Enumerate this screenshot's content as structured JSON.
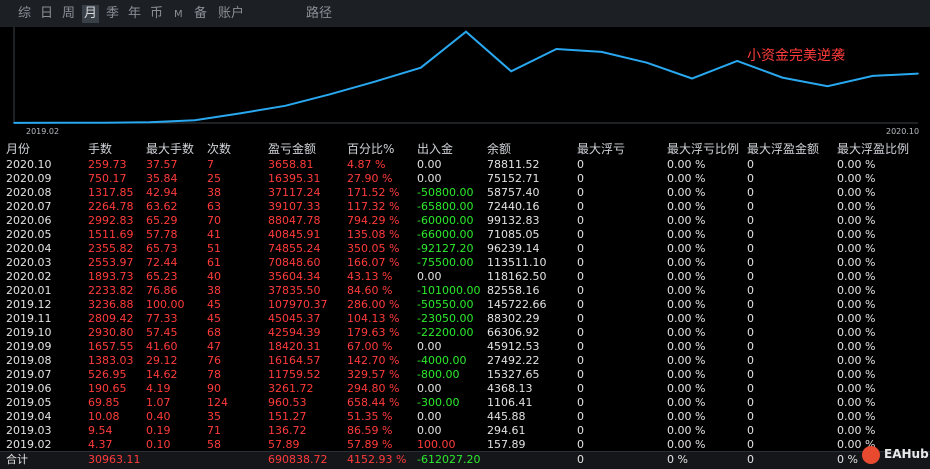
{
  "tabs": [
    {
      "label": "综",
      "active": false
    },
    {
      "label": "日",
      "active": false
    },
    {
      "label": "周",
      "active": false
    },
    {
      "label": "月",
      "active": true
    },
    {
      "label": "季",
      "active": false
    },
    {
      "label": "年",
      "active": false
    },
    {
      "label": "币",
      "active": false
    },
    {
      "label": "M",
      "active": false
    },
    {
      "label": "备",
      "active": false
    },
    {
      "label": "账户",
      "active": false
    },
    {
      "label": "路径",
      "active": false
    }
  ],
  "chart": {
    "annotation": "小资金完美逆袭",
    "x_start": "2019.02",
    "x_end": "2020.10",
    "line_color": "#29a8f0"
  },
  "chart_data": {
    "type": "line",
    "title": "",
    "x": [
      "2019.02",
      "2019.03",
      "2019.04",
      "2019.05",
      "2019.06",
      "2019.07",
      "2019.08",
      "2019.09",
      "2019.10",
      "2019.11",
      "2019.12",
      "2020.01",
      "2020.02",
      "2020.03",
      "2020.04",
      "2020.05",
      "2020.06",
      "2020.07",
      "2020.08",
      "2020.09",
      "2020.10"
    ],
    "series": [
      {
        "values": [
          157.89,
          294.61,
          445.88,
          1106.41,
          4368.13,
          15327.65,
          27492.22,
          45912.53,
          66306.92,
          88302.29,
          145722.66,
          82558.16,
          118162.5,
          113511.1,
          96239.14,
          71085.05,
          99132.83,
          72440.16,
          58757.4,
          75152.71,
          78811.52
        ]
      }
    ],
    "xlabel": "",
    "ylabel": ""
  },
  "table": {
    "headers": [
      "月份",
      "手数",
      "最大手数",
      "次数",
      "盈亏金额",
      "百分比%",
      "出入金",
      "余额",
      "最大浮亏",
      "最大浮亏比例",
      "最大浮盈金额",
      "最大浮盈比例"
    ],
    "rows": [
      [
        "2020.10",
        "259.73",
        "37.57",
        "7",
        "3658.81",
        "4.87 %",
        "0.00",
        "78811.52",
        "0",
        "0.00 %",
        "0",
        "0.00 %"
      ],
      [
        "2020.09",
        "750.17",
        "35.84",
        "25",
        "16395.31",
        "27.90 %",
        "0.00",
        "75152.71",
        "0",
        "0.00 %",
        "0",
        "0.00 %"
      ],
      [
        "2020.08",
        "1317.85",
        "42.94",
        "38",
        "37117.24",
        "171.52 %",
        "-50800.00",
        "58757.40",
        "0",
        "0.00 %",
        "0",
        "0.00 %"
      ],
      [
        "2020.07",
        "2264.78",
        "63.62",
        "63",
        "39107.33",
        "117.32 %",
        "-65800.00",
        "72440.16",
        "0",
        "0.00 %",
        "0",
        "0.00 %"
      ],
      [
        "2020.06",
        "2992.83",
        "65.29",
        "70",
        "88047.78",
        "794.29 %",
        "-60000.00",
        "99132.83",
        "0",
        "0.00 %",
        "0",
        "0.00 %"
      ],
      [
        "2020.05",
        "1511.69",
        "57.78",
        "41",
        "40845.91",
        "135.08 %",
        "-66000.00",
        "71085.05",
        "0",
        "0.00 %",
        "0",
        "0.00 %"
      ],
      [
        "2020.04",
        "2355.82",
        "65.73",
        "51",
        "74855.24",
        "350.05 %",
        "-92127.20",
        "96239.14",
        "0",
        "0.00 %",
        "0",
        "0.00 %"
      ],
      [
        "2020.03",
        "2553.97",
        "72.44",
        "61",
        "70848.60",
        "166.07 %",
        "-75500.00",
        "113511.10",
        "0",
        "0.00 %",
        "0",
        "0.00 %"
      ],
      [
        "2020.02",
        "1893.73",
        "65.23",
        "40",
        "35604.34",
        "43.13 %",
        "0.00",
        "118162.50",
        "0",
        "0.00 %",
        "0",
        "0.00 %"
      ],
      [
        "2020.01",
        "2233.82",
        "76.86",
        "38",
        "37835.50",
        "84.60 %",
        "-101000.00",
        "82558.16",
        "0",
        "0.00 %",
        "0",
        "0.00 %"
      ],
      [
        "2019.12",
        "3236.88",
        "100.00",
        "45",
        "107970.37",
        "286.00 %",
        "-50550.00",
        "145722.66",
        "0",
        "0.00 %",
        "0",
        "0.00 %"
      ],
      [
        "2019.11",
        "2809.42",
        "77.33",
        "45",
        "45045.37",
        "104.13 %",
        "-23050.00",
        "88302.29",
        "0",
        "0.00 %",
        "0",
        "0.00 %"
      ],
      [
        "2019.10",
        "2930.80",
        "57.45",
        "68",
        "42594.39",
        "179.63 %",
        "-22200.00",
        "66306.92",
        "0",
        "0.00 %",
        "0",
        "0.00 %"
      ],
      [
        "2019.09",
        "1657.55",
        "41.60",
        "47",
        "18420.31",
        "67.00 %",
        "0.00",
        "45912.53",
        "0",
        "0.00 %",
        "0",
        "0.00 %"
      ],
      [
        "2019.08",
        "1383.03",
        "29.12",
        "76",
        "16164.57",
        "142.70 %",
        "-4000.00",
        "27492.22",
        "0",
        "0.00 %",
        "0",
        "0.00 %"
      ],
      [
        "2019.07",
        "526.95",
        "14.62",
        "78",
        "11759.52",
        "329.57 %",
        "-800.00",
        "15327.65",
        "0",
        "0.00 %",
        "0",
        "0.00 %"
      ],
      [
        "2019.06",
        "190.65",
        "4.19",
        "90",
        "3261.72",
        "294.80 %",
        "0.00",
        "4368.13",
        "0",
        "0.00 %",
        "0",
        "0.00 %"
      ],
      [
        "2019.05",
        "69.85",
        "1.07",
        "124",
        "960.53",
        "658.44 %",
        "-300.00",
        "1106.41",
        "0",
        "0.00 %",
        "0",
        "0.00 %"
      ],
      [
        "2019.04",
        "10.08",
        "0.40",
        "35",
        "151.27",
        "51.35 %",
        "0.00",
        "445.88",
        "0",
        "0.00 %",
        "0",
        "0.00 %"
      ],
      [
        "2019.03",
        "9.54",
        "0.19",
        "71",
        "136.72",
        "86.59 %",
        "0.00",
        "294.61",
        "0",
        "0.00 %",
        "0",
        "0.00 %"
      ],
      [
        "2019.02",
        "4.37",
        "0.10",
        "58",
        "57.89",
        "57.89 %",
        "100.00",
        "157.89",
        "0",
        "0.00 %",
        "0",
        "0.00 %"
      ]
    ],
    "total": [
      "合计",
      "30963.11",
      "",
      "",
      "690838.72",
      "4152.93 %",
      "-612027.20",
      "",
      "0",
      "0 %",
      "0",
      "0 %"
    ]
  },
  "colors": {
    "loss": "#ff3b3b",
    "gain": "#2dea2d",
    "neutral": "#e2e2e2"
  },
  "brand": {
    "logo_icon": "eahub-logo-icon",
    "label": "EAHub"
  }
}
